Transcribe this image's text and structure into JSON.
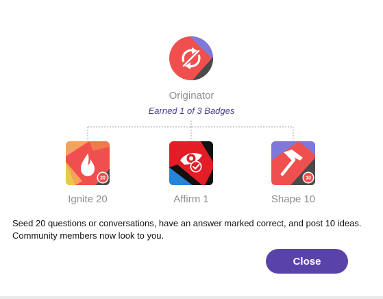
{
  "dialog": {
    "main_badge": {
      "title": "Originator",
      "icon": "refresh-arrows-icon",
      "earned_text": "Earned 1 of 3 Badges"
    },
    "sub_badges": [
      {
        "label": "Ignite 20",
        "icon": "flame-icon",
        "count": "20",
        "status": "locked"
      },
      {
        "label": "Affirm 1",
        "icon": "eye-check-icon",
        "status": "earned"
      },
      {
        "label": "Shape 10",
        "icon": "hammer-icon",
        "count": "10",
        "status": "locked"
      }
    ],
    "description": "Seed 20 questions or conversations, have an answer marked correct, and post 10 ideas. Community members now look to you.",
    "close_label": "Close"
  },
  "colors": {
    "accent": "#5a43a8",
    "earned_text": "#4a3c8c",
    "badge_red": "#f0504d",
    "badge_purple": "#7e78d8",
    "badge_dark": "#4a4a4a",
    "muted_text": "#8e8e8e"
  }
}
